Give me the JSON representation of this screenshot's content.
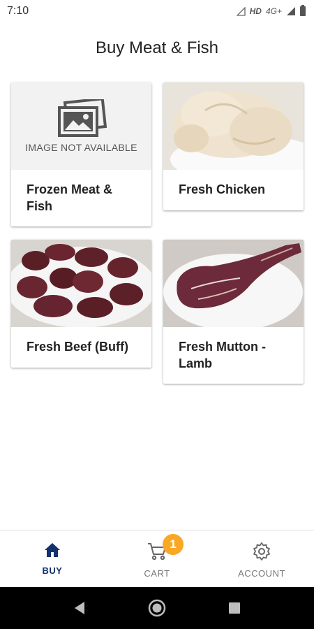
{
  "status_bar": {
    "time": "7:10",
    "network": "HD",
    "network_type": "4G+"
  },
  "header": {
    "title": "Buy Meat & Fish"
  },
  "categories": [
    {
      "label": "Frozen Meat & Fish",
      "image": "image-not-available",
      "placeholder_text": "IMAGE NOT AVAILABLE"
    },
    {
      "label": "Fresh Chicken",
      "image": "raw-chicken-photo"
    },
    {
      "label": "Fresh Beef (Buff)",
      "image": "raw-beef-pieces-photo"
    },
    {
      "label": "Fresh Mutton - Lamb",
      "image": "lamb-leg-photo"
    }
  ],
  "bottom_nav": {
    "items": [
      {
        "label": "BUY",
        "icon": "home-icon",
        "active": true
      },
      {
        "label": "CART",
        "icon": "cart-icon",
        "badge": "1"
      },
      {
        "label": "ACCOUNT",
        "icon": "gear-icon"
      }
    ]
  },
  "colors": {
    "active_nav": "#13316f",
    "badge": "#f9a825",
    "inactive_nav": "#777777"
  }
}
